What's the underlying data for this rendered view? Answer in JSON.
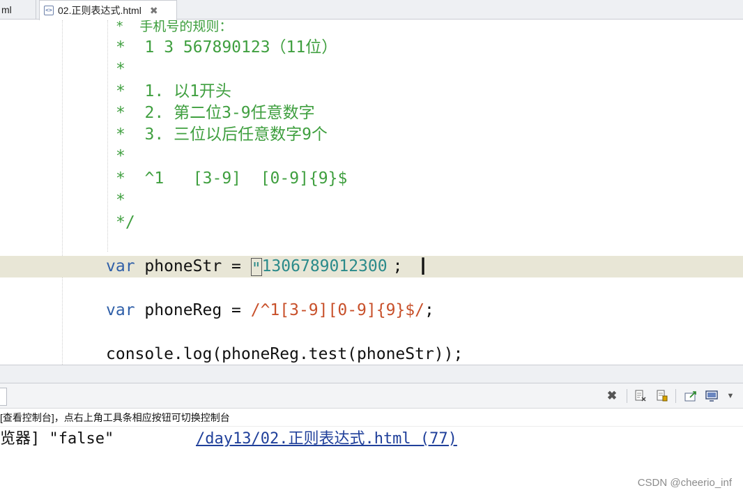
{
  "tabs": [
    {
      "label": "ml"
    },
    {
      "label": "02.正则表达式.html",
      "icon": "html-file-icon",
      "close": "✖"
    }
  ],
  "editor": {
    "comment_lines": [
      "*  手机号的规则：",
      "*  1 3 567890123（11位）",
      "*",
      "*  1. 以1开头",
      "*  2. 第二位3-9任意数字",
      "*  3. 三位以后任意数字9个",
      "*",
      "*  ^1   [3-9]  [0-9]{9}$",
      "*",
      "*/"
    ],
    "code": {
      "l1": {
        "kw": "var",
        "name": " phoneStr = ",
        "quote": "\"",
        "str": "1306789012300",
        "end": ";"
      },
      "l2": {
        "kw": "var",
        "name": " phoneReg = ",
        "regex": "/^1[3-9][0-9]{9}$/",
        "end": ";"
      },
      "l3": {
        "text": "console.log(phoneReg.test(phoneStr));"
      }
    },
    "cursor": "I"
  },
  "console": {
    "hint": "[查看控制台]，点右上角工具条相应按钮可切换控制台",
    "output_source": "览器] \"false\"",
    "output_link": "/day13/02.正则表达式.html (77)"
  },
  "toolbar_icons": [
    "clear-icon",
    "remove-launch-icon",
    "scroll-lock-icon",
    "pin-console-icon",
    "display-console-icon",
    "dropdown-icon"
  ],
  "watermark": "CSDN @cheerio_inf",
  "colors": {
    "comment": "#3f9f3f",
    "keyword": "#2f5fa8",
    "string": "#2a8a8a",
    "regex": "#c8502a",
    "link": "#1f3f9a",
    "current_line": "#e8e6d6"
  }
}
